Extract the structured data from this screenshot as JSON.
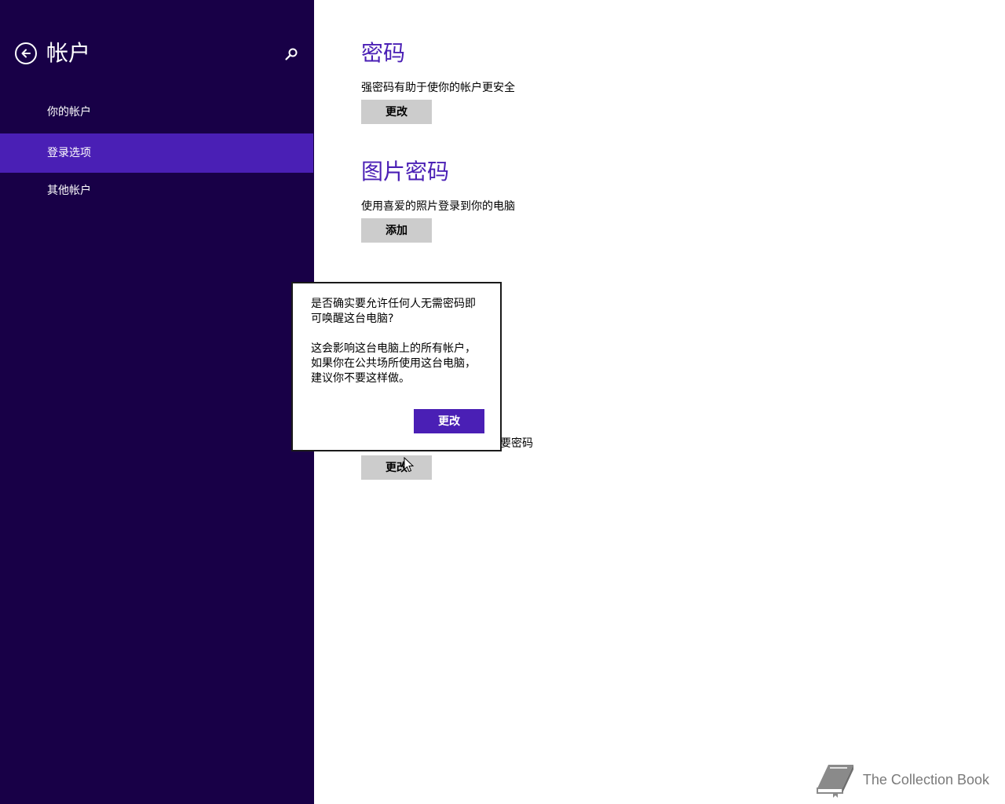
{
  "sidebar": {
    "title": "帐户",
    "back_icon": "back-arrow-icon",
    "search_icon": "search-icon",
    "items": [
      {
        "label": "你的帐户",
        "selected": false
      },
      {
        "label": "登录选项",
        "selected": true
      },
      {
        "label": "其他帐户",
        "selected": false
      }
    ]
  },
  "main": {
    "sections": [
      {
        "title": "密码",
        "description": "强密码有助于使你的帐户更安全",
        "button": "更改"
      },
      {
        "title": "图片密码",
        "description": "使用喜爱的照片登录到你的电脑",
        "button": "添加"
      },
      {
        "description_partial": "要密码",
        "button": "更改"
      }
    ]
  },
  "flyout": {
    "question": "是否确实要允许任何人无需密码即可唤醒这台电脑?",
    "body": "这会影响这台电脑上的所有帐户，如果你在公共场所使用这台电脑，建议你不要这样做。",
    "confirm_button": "更改"
  },
  "watermark": {
    "text": "The Collection Book",
    "icon": "book-icon"
  },
  "colors": {
    "sidebar_bg": "#180047",
    "accent": "#4a1fb5",
    "button_gray": "#cccccc"
  }
}
